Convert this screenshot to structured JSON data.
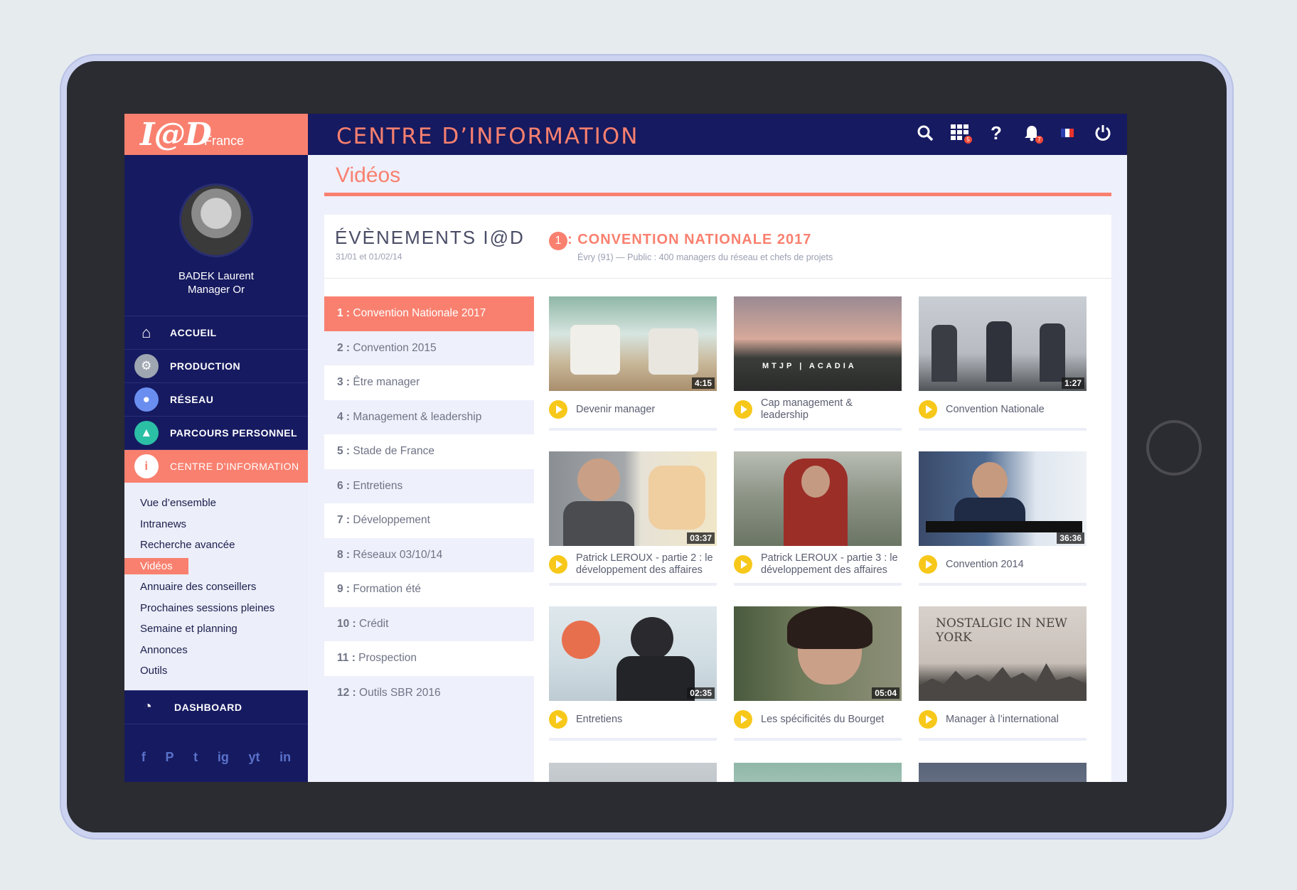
{
  "brand": {
    "logo": "I@D",
    "country": "France"
  },
  "user": {
    "name": "BADEK Laurent",
    "role": "Manager Or"
  },
  "nav": [
    {
      "label": "ACCUEIL",
      "icon": "home-icon"
    },
    {
      "label": "PRODUCTION",
      "icon": "gears-icon"
    },
    {
      "label": "RÉSEAU",
      "icon": "users-icon"
    },
    {
      "label": "PARCOURS PERSONNEL",
      "icon": "graduation-cap-icon"
    },
    {
      "label": "CENTRE D’INFORMATION",
      "icon": "info-icon"
    }
  ],
  "subnav": [
    "Vue d’ensemble",
    "Intranews",
    "Recherche avancée",
    "Vidéos",
    "Annuaire des conseillers",
    "Prochaines sessions pleines",
    "Semaine et planning",
    "Annonces",
    "Outils"
  ],
  "dashboard": "DASHBOARD",
  "social": [
    "f",
    "P",
    "t",
    "ig",
    "yt",
    "in"
  ],
  "header": {
    "title": "CENTRE D’INFORMATION",
    "apps_badge": "5",
    "notif_badge": "7"
  },
  "page": {
    "title": "Vidéos"
  },
  "events": {
    "heading": "ÉVÈNEMENTS I@D",
    "dates": "31/01 et 01/02/14",
    "selected_num": "1",
    "selected_title": ": CONVENTION NATIONALE 2017",
    "selected_sub": "Évry (91) — Public : 400 managers du réseau et chefs de projets",
    "list": [
      {
        "num": "1 :",
        "label": " Convention Nationale 2017"
      },
      {
        "num": "2 :",
        "label": " Convention 2015"
      },
      {
        "num": "3 :",
        "label": " Être manager"
      },
      {
        "num": "4 :",
        "label": " Management & leadership"
      },
      {
        "num": "5 :",
        "label": " Stade de France"
      },
      {
        "num": "6 :",
        "label": " Entretiens"
      },
      {
        "num": "7 :",
        "label": " Développement"
      },
      {
        "num": "8 :",
        "label": " Réseaux 03/10/14"
      },
      {
        "num": "9 :",
        "label": " Formation été"
      },
      {
        "num": "10 :",
        "label": " Crédit"
      },
      {
        "num": "11 :",
        "label": " Prospection"
      },
      {
        "num": "12 :",
        "label": " Outils SBR 2016"
      }
    ]
  },
  "videos": [
    {
      "title": "Devenir manager",
      "duration": "4:15"
    },
    {
      "title": "Cap management & leadership",
      "duration": ""
    },
    {
      "title": "Convention Nationale",
      "duration": "1:27"
    },
    {
      "title": "Patrick LEROUX - partie 2 : le développement des affaires",
      "duration": "03:37"
    },
    {
      "title": "Patrick LEROUX - partie 3 : le développement des affaires",
      "duration": ""
    },
    {
      "title": "Convention 2014",
      "duration": "36:36"
    },
    {
      "title": "Entretiens",
      "duration": "02:35"
    },
    {
      "title": "Les spécificités du Bourget",
      "duration": "05:04"
    },
    {
      "title": "Manager à l’international",
      "duration": ""
    }
  ],
  "thumb_overlays": {
    "acadia": "MTJP | ACADIA",
    "nostalgic": "NOSTALGIC IN NEW YORK"
  },
  "colors": {
    "navy": "#161a60",
    "coral": "#f9806f",
    "play": "#f7c81a"
  }
}
